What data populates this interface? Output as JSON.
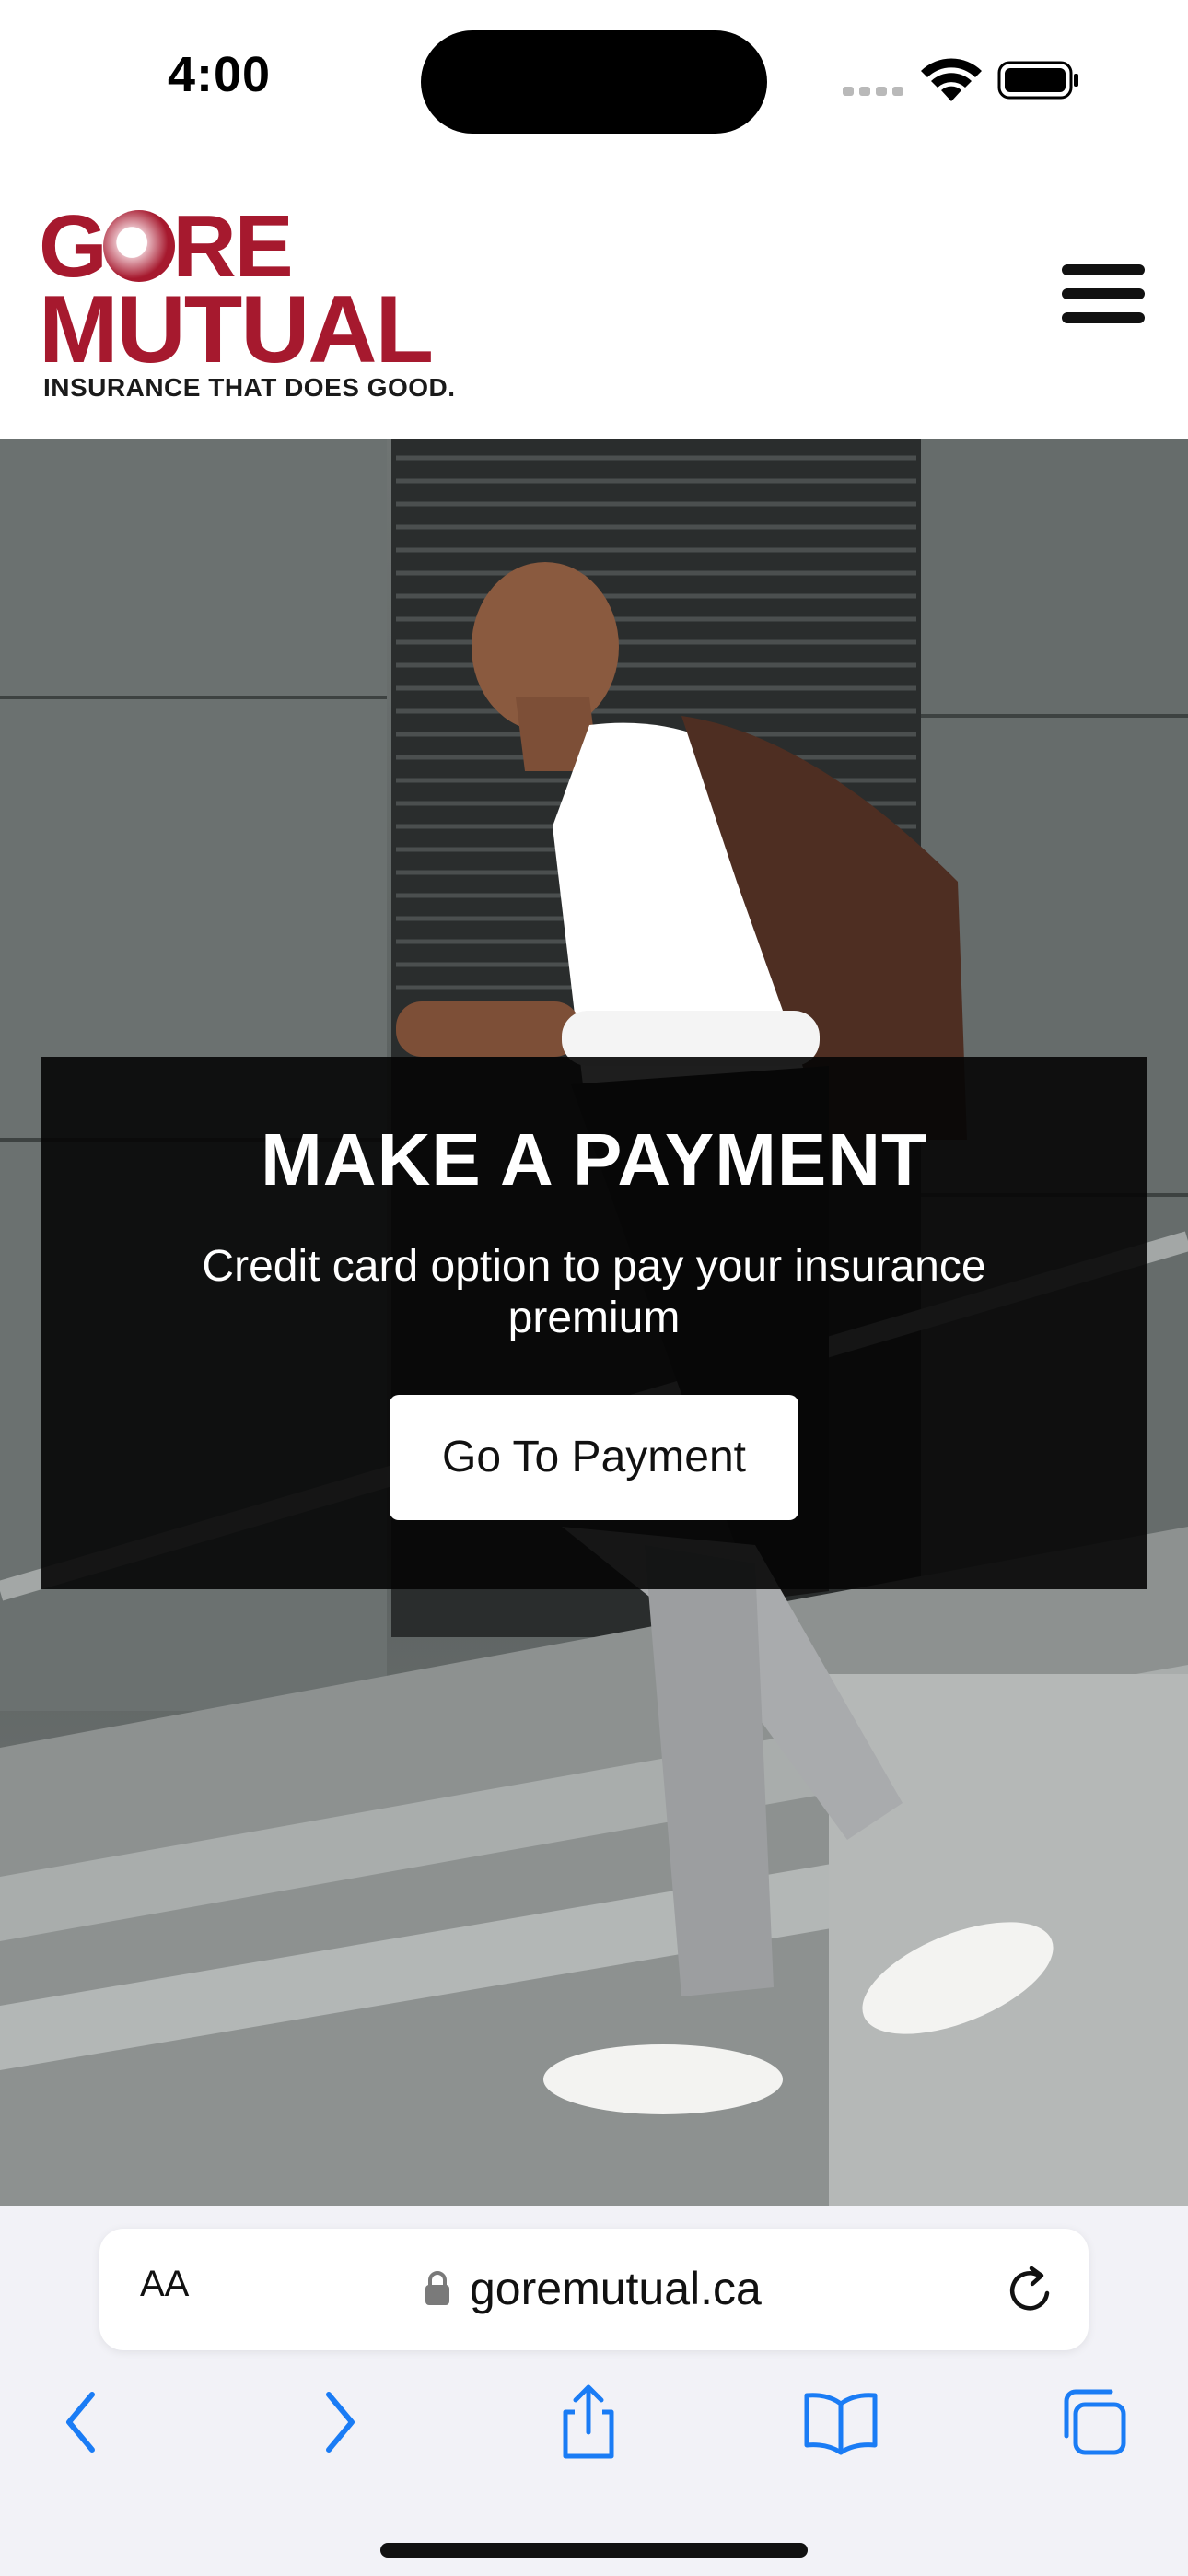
{
  "status_bar": {
    "time": "4:00"
  },
  "header": {
    "logo": {
      "line1": "GORE",
      "line2": "MUTUAL",
      "tagline": "INSURANCE THAT DOES GOOD."
    },
    "menu_icon": "hamburger-menu-icon"
  },
  "hero": {
    "title": "MAKE A PAYMENT",
    "subtitle": "Credit card option to pay your insurance premium",
    "button_label": "Go To Payment"
  },
  "browser": {
    "text_size_label": "AA",
    "url": "goremutual.ca",
    "toolbar": [
      "back-icon",
      "forward-icon",
      "share-icon",
      "bookmarks-icon",
      "tabs-icon"
    ]
  },
  "colors": {
    "brand_red": "#a6192e",
    "ios_blue": "#1a7cf5",
    "overlay": "#050505"
  }
}
